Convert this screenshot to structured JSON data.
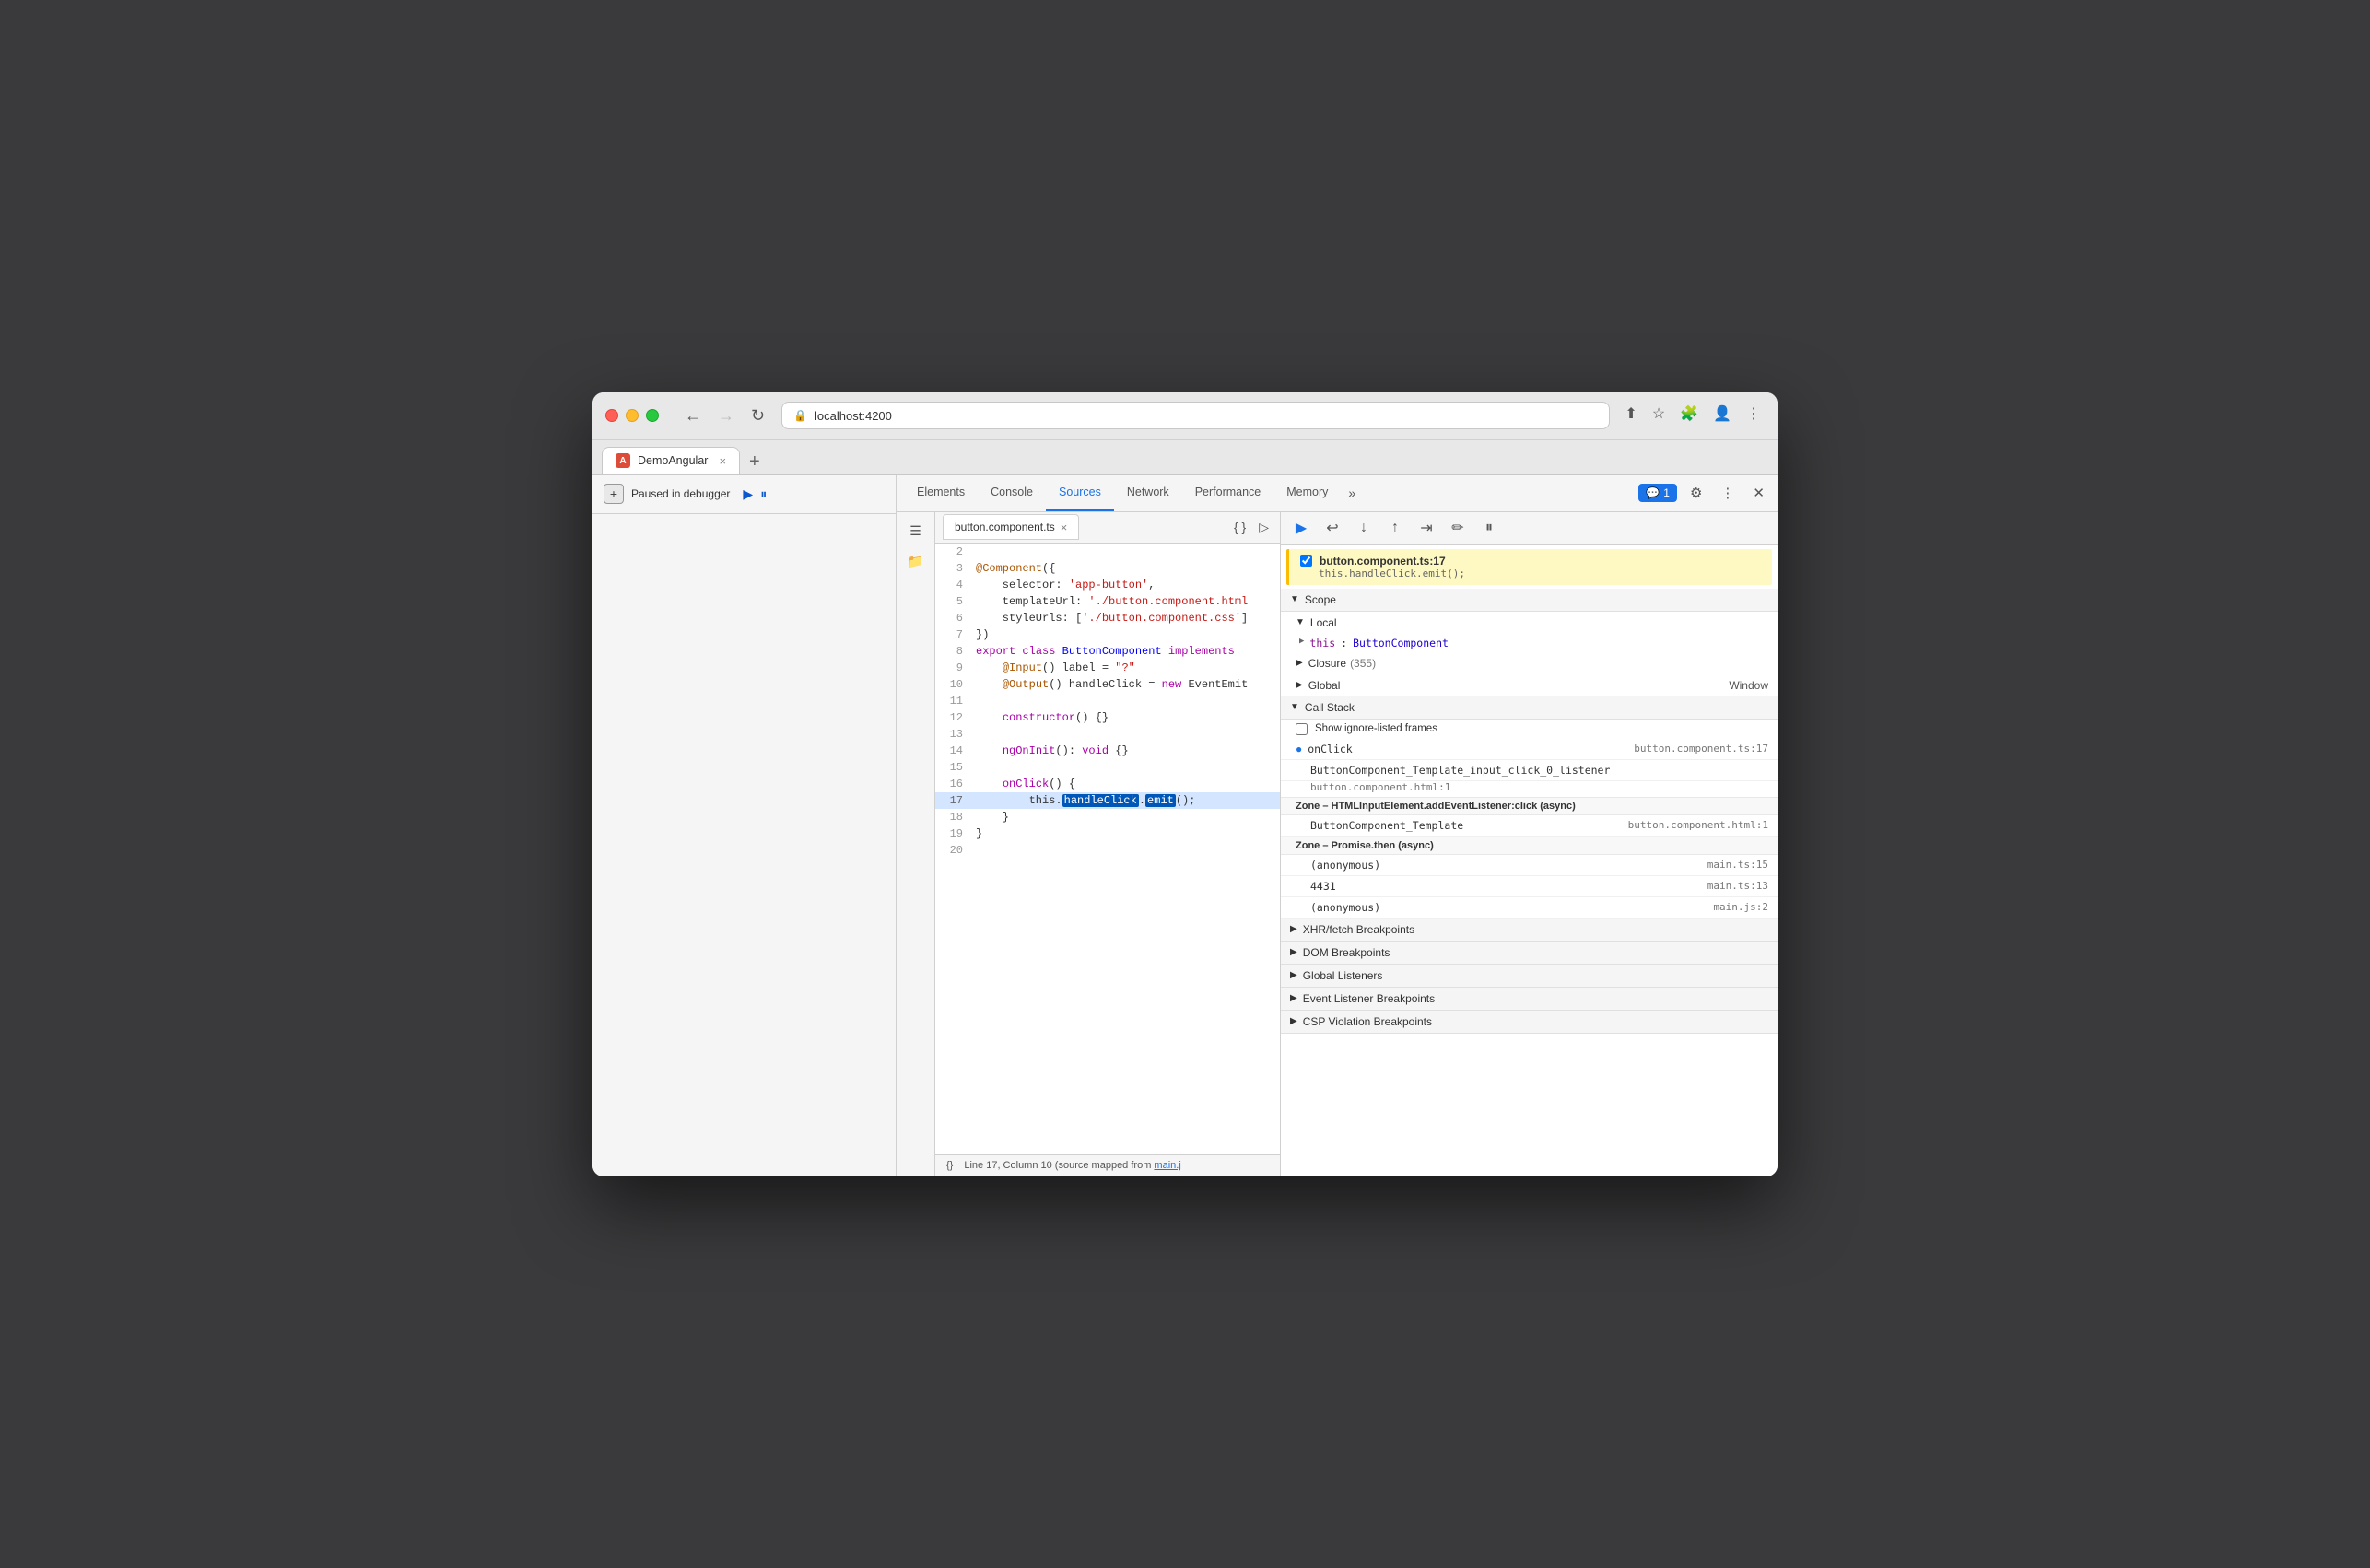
{
  "browser": {
    "tab_title": "DemoAngular",
    "tab_close": "×",
    "new_tab": "+",
    "address": "localhost:4200",
    "nav_back": "←",
    "nav_forward": "→",
    "nav_refresh": "↻"
  },
  "devtools": {
    "tabs": [
      "Elements",
      "Console",
      "Sources",
      "Network",
      "Performance",
      "Memory"
    ],
    "active_tab": "Sources",
    "more_tabs": "»",
    "badge_label": "1",
    "controls": [
      "⚙",
      "⋮",
      "×"
    ]
  },
  "sources": {
    "file_tab": "button.component.ts",
    "file_close": "×"
  },
  "debugger": {
    "paused_text": "Paused in debugger",
    "resume_title": "Resume script execution",
    "step_over_title": "Step over",
    "step_into_title": "Step into",
    "step_out_title": "Step out",
    "step_title": "Step",
    "deactivate_title": "Deactivate breakpoints",
    "pause_title": "Pause on exceptions"
  },
  "code": {
    "lines": [
      {
        "num": 2,
        "content": ""
      },
      {
        "num": 3,
        "content": "@Component({"
      },
      {
        "num": 4,
        "content": "  selector: 'app-button',"
      },
      {
        "num": 5,
        "content": "  templateUrl: './button.component.html"
      },
      {
        "num": 6,
        "content": "  styleUrls: ['./button.component.css']"
      },
      {
        "num": 7,
        "content": "})"
      },
      {
        "num": 8,
        "content": "export class ButtonComponent implements"
      },
      {
        "num": 9,
        "content": "  @Input() label = \"?\""
      },
      {
        "num": 10,
        "content": "  @Output() handleClick = new EventEmit"
      },
      {
        "num": 11,
        "content": ""
      },
      {
        "num": 12,
        "content": "  constructor() {}"
      },
      {
        "num": 13,
        "content": ""
      },
      {
        "num": 14,
        "content": "  ngOnInit(): void {}"
      },
      {
        "num": 15,
        "content": ""
      },
      {
        "num": 16,
        "content": "  onClick() {"
      },
      {
        "num": 17,
        "content": "    this.handleClick.emit();",
        "highlighted": true
      },
      {
        "num": 18,
        "content": "  }"
      },
      {
        "num": 19,
        "content": "}"
      },
      {
        "num": 20,
        "content": ""
      }
    ],
    "status_bar": "Line 17, Column 10 (source mapped from main.j"
  },
  "debug_panel": {
    "breakpoint": {
      "filename": "button.component.ts:17",
      "code": "this.handleClick.emit();"
    },
    "scope": {
      "title": "Scope",
      "local": {
        "label": "Local",
        "this_label": "this",
        "this_value": "ButtonComponent"
      },
      "closure": {
        "label": "Closure",
        "count": "(355)"
      },
      "global": {
        "label": "Global",
        "value": "Window"
      }
    },
    "call_stack": {
      "title": "Call Stack",
      "ignore_frames_label": "Show ignore-listed frames",
      "items": [
        {
          "fn": "onClick",
          "file": "button.component.ts:17"
        },
        {
          "fn": "ButtonComponent_Template_input_click_0_listener",
          "file": "button.component.html:1"
        },
        {
          "zone": "Zone – HTMLInputElement.addEventListener:click (async)"
        },
        {
          "fn": "ButtonComponent_Template",
          "file": "button.component.html:1"
        },
        {
          "zone": "Zone – Promise.then (async)"
        },
        {
          "fn": "(anonymous)",
          "file": "main.ts:15"
        },
        {
          "fn": "4431",
          "file": "main.ts:13"
        },
        {
          "fn": "(anonymous)",
          "file": "main.js:2"
        }
      ]
    },
    "sections": [
      {
        "title": "XHR/fetch Breakpoints",
        "expanded": false
      },
      {
        "title": "DOM Breakpoints",
        "expanded": false
      },
      {
        "title": "Global Listeners",
        "expanded": false
      },
      {
        "title": "Event Listener Breakpoints",
        "expanded": false
      },
      {
        "title": "CSP Violation Breakpoints",
        "expanded": false
      }
    ]
  }
}
